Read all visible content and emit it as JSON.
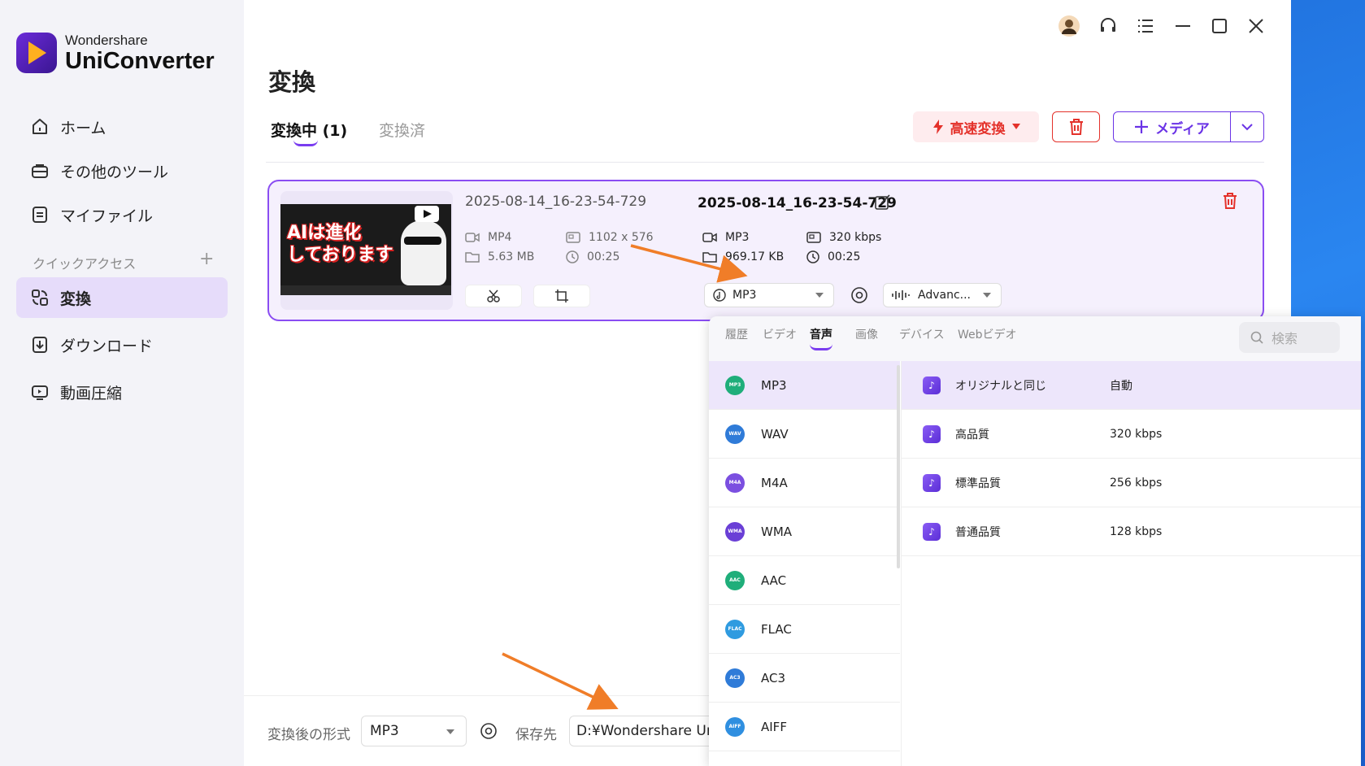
{
  "app": {
    "brand_top": "Wondershare",
    "brand_main": "UniConverter"
  },
  "sidebar": {
    "items": [
      {
        "label": "ホーム",
        "icon": "home-icon"
      },
      {
        "label": "その他のツール",
        "icon": "toolbox-icon"
      },
      {
        "label": "マイファイル",
        "icon": "file-icon"
      },
      {
        "label": "変換",
        "icon": "convert-icon",
        "active": true
      },
      {
        "label": "ダウンロード",
        "icon": "download-icon"
      },
      {
        "label": "動画圧縮",
        "icon": "compress-icon"
      }
    ],
    "quick_access": "クイックアクセス"
  },
  "main": {
    "title": "変換",
    "tabs": [
      {
        "label": "変換中 (1)"
      },
      {
        "label": "変換済"
      }
    ],
    "fast_convert": "高速変換",
    "add_media": "メディア"
  },
  "card": {
    "thumb_text": "AIは進化\nしております",
    "source": {
      "name": "2025-08-14_16-23-54-729",
      "format": "MP4",
      "resolution": "1102 x 576",
      "size": "5.63 MB",
      "duration": "00:25"
    },
    "target": {
      "name": "2025-08-14_16-23-54-729",
      "format": "MP3",
      "bitrate": "320 kbps",
      "size": "969.17 KB",
      "duration": "00:25"
    },
    "format_select": "MP3",
    "advanced_select": "Advanc..."
  },
  "bottom": {
    "format_label": "変換後の形式",
    "format_value": "MP3",
    "save_label": "保存先",
    "save_path": "D:¥Wondershare UniConverter"
  },
  "panel": {
    "tabs": [
      "履歴",
      "ビデオ",
      "音声",
      "画像",
      "デバイス",
      "Webビデオ"
    ],
    "active_tab": "音声",
    "search_placeholder": "検索",
    "formats": [
      {
        "name": "MP3",
        "badge": "MP3",
        "color": "#1fae7a"
      },
      {
        "name": "WAV",
        "badge": "WAV",
        "color": "#2f7bd8"
      },
      {
        "name": "M4A",
        "badge": "M4A",
        "color": "#7b4fe0"
      },
      {
        "name": "WMA",
        "badge": "WMA",
        "color": "#6a3fd6"
      },
      {
        "name": "AAC",
        "badge": "AAC",
        "color": "#1fae7a"
      },
      {
        "name": "FLAC",
        "badge": "FLAC",
        "color": "#2f9be0"
      },
      {
        "name": "AC3",
        "badge": "AC3",
        "color": "#2f7bd8"
      },
      {
        "name": "AIFF",
        "badge": "AIFF",
        "color": "#2f8fe0"
      }
    ],
    "qualities": [
      {
        "name": "オリジナルと同じ",
        "value": "自動"
      },
      {
        "name": "高品質",
        "value": "320 kbps"
      },
      {
        "name": "標準品質",
        "value": "256 kbps"
      },
      {
        "name": "普通品質",
        "value": "128 kbps"
      }
    ]
  },
  "colors": {
    "accent": "#7a3cf0",
    "danger": "#e4322b",
    "arrow": "#f07d28"
  }
}
